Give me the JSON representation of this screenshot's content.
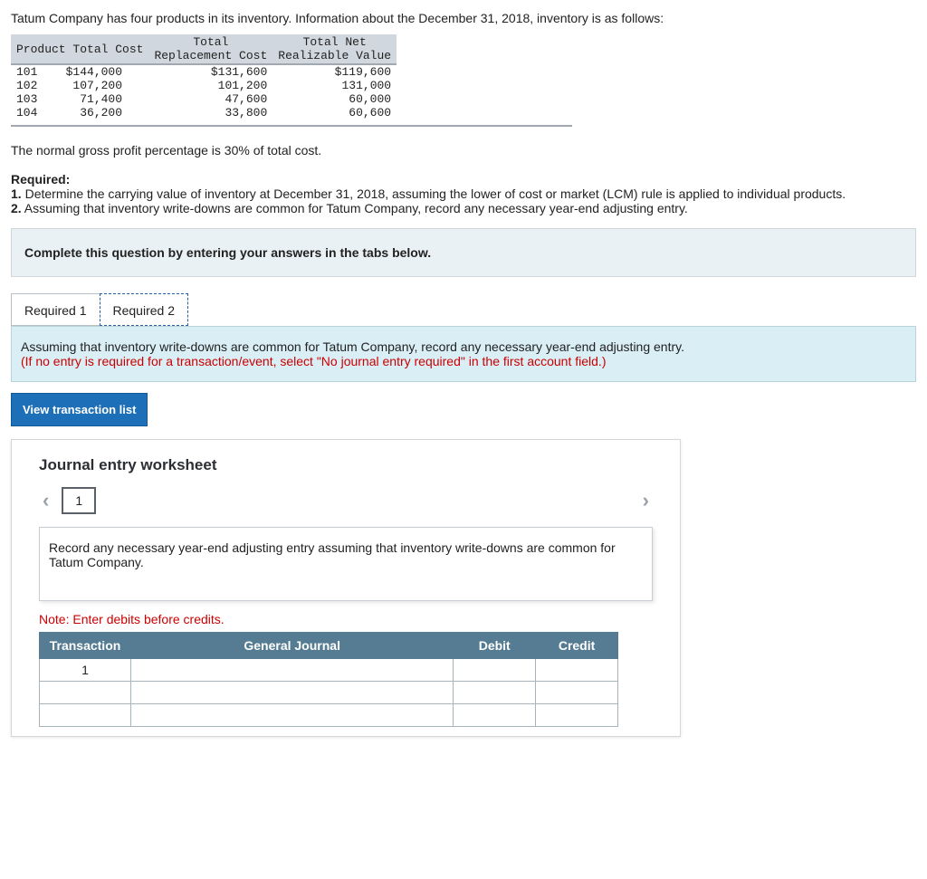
{
  "intro": "Tatum Company has four products in its inventory. Information about the December 31, 2018, inventory is as follows:",
  "table": {
    "headers": {
      "product": "Product",
      "cost": "Total Cost",
      "replacement": "Total\nReplacement Cost",
      "nrv": "Total Net\nRealizable Value"
    },
    "rows": [
      {
        "product": "101",
        "cost": "$144,000",
        "replacement": "$131,600",
        "nrv": "$119,600"
      },
      {
        "product": "102",
        "cost": "107,200",
        "replacement": "101,200",
        "nrv": "131,000"
      },
      {
        "product": "103",
        "cost": "71,400",
        "replacement": "47,600",
        "nrv": "60,000"
      },
      {
        "product": "104",
        "cost": "36,200",
        "replacement": "33,800",
        "nrv": "60,600"
      }
    ]
  },
  "gross_profit_note": "The normal gross profit percentage is 30% of total cost.",
  "required": {
    "heading": "Required:",
    "item1": "1. Determine the carrying value of inventory at December 31, 2018, assuming the lower of cost or market (LCM) rule is applied to individual products.",
    "item2": "2. Assuming that inventory write-downs are common for Tatum Company, record any necessary year-end adjusting entry."
  },
  "instruction_box": "Complete this question by entering your answers in the tabs below.",
  "tabs": {
    "tab1": "Required 1",
    "tab2": "Required 2"
  },
  "tab2_content": {
    "line1": "Assuming that inventory write-downs are common for Tatum Company, record any necessary year-end adjusting entry.",
    "line2": "(If no entry is required for a transaction/event, select \"No journal entry required\" in the first account field.)"
  },
  "view_transaction_btn": "View transaction list",
  "worksheet": {
    "title": "Journal entry worksheet",
    "step": "1",
    "prompt": "Record any necessary year-end adjusting entry assuming that inventory write-downs are common for Tatum Company.",
    "note": "Note: Enter debits before credits.",
    "headers": {
      "transaction": "Transaction",
      "general_journal": "General Journal",
      "debit": "Debit",
      "credit": "Credit"
    },
    "first_transaction": "1"
  }
}
